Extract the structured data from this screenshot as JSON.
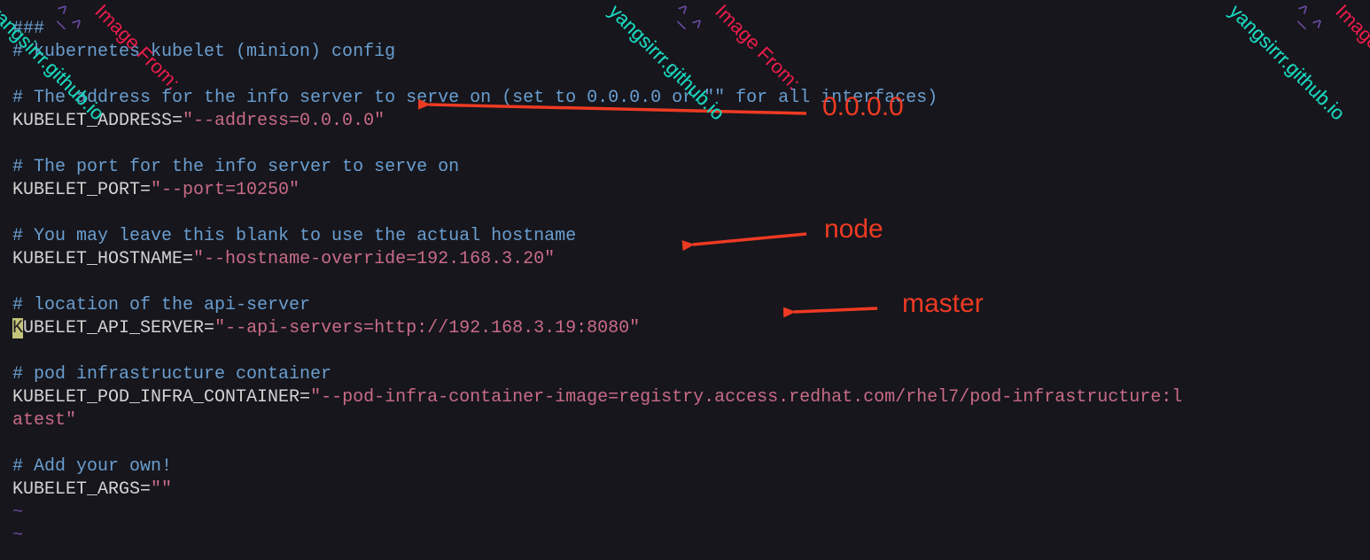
{
  "lines": {
    "hash": "###",
    "c1": "# kubernetes kubelet (minion) config",
    "c2": "# The address for the info server to serve on (set to 0.0.0.0 or \"\" for all interfaces)",
    "k_addr": "KUBELET_ADDRESS=",
    "v_addr": "\"--address=0.0.0.0\"",
    "c3": "# The port for the info server to serve on",
    "k_port": "KUBELET_PORT=",
    "v_port": "\"--port=10250\"",
    "c4": "# You may leave this blank to use the actual hostname",
    "k_host": "KUBELET_HOSTNAME=",
    "v_host": "\"--hostname-override=192.168.3.20\"",
    "c5": "# location of the api-server",
    "k_api_cur": "K",
    "k_api_rest": "UBELET_API_SERVER=",
    "v_api": "\"--api-servers=http://192.168.3.19:8080\"",
    "c6": "# pod infrastructure container",
    "k_pod": "KUBELET_POD_INFRA_CONTAINER=",
    "v_pod1": "\"--pod-infra-container-image=registry.access.redhat.com/rhel7/pod-infrastructure:l",
    "v_pod2": "atest\"",
    "c7": "# Add your own!",
    "k_args": "KUBELET_ARGS=",
    "v_args": "\"\"",
    "tilde": "~"
  },
  "annotations": {
    "a1": "0.0.0.0",
    "a2": "node",
    "a3": "master"
  },
  "watermark": {
    "caret": "^_^",
    "from": "Image From:",
    "site": "yangsirrr.github.io"
  }
}
